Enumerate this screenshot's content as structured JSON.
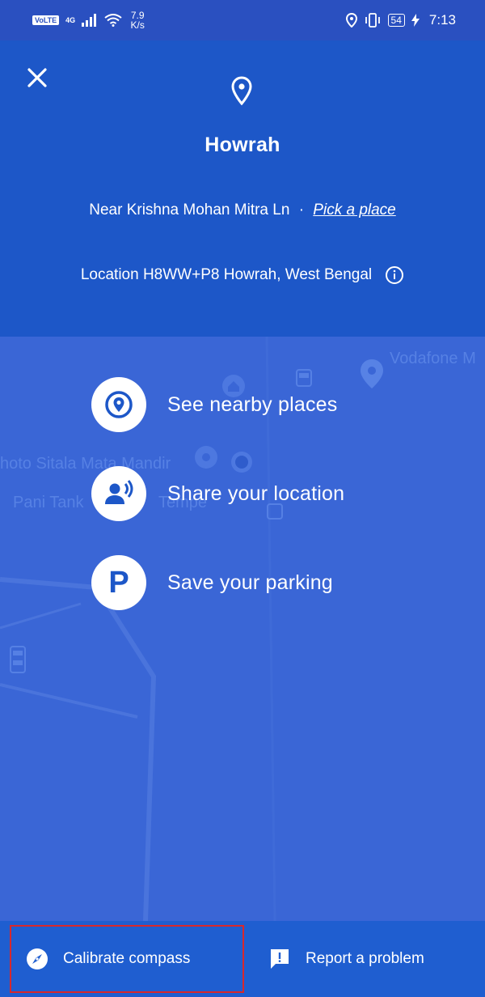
{
  "status_bar": {
    "volte": "VoLTE",
    "network": "4G",
    "speed_value": "7.9",
    "speed_unit": "K/s",
    "battery": "54",
    "time": "7:13"
  },
  "header": {
    "title": "Howrah",
    "address": "Near Krishna Mohan Mitra Ln",
    "separator": "·",
    "pick_place_link": "Pick a place",
    "location_code": "Location H8WW+P8 Howrah, West Bengal"
  },
  "map_labels": {
    "vodafone": "Vodafone M",
    "temple": "hoto Sitala Mata Mandir",
    "tank": "Pani Tank",
    "tank_suffix": "Tempe"
  },
  "actions": [
    {
      "label": "See nearby places",
      "icon": "nearby-places-icon"
    },
    {
      "label": "Share your location",
      "icon": "share-location-icon"
    },
    {
      "label": "Save your parking",
      "icon": "parking-icon"
    }
  ],
  "parking_glyph": "P",
  "bottom_bar": {
    "calibrate_label": "Calibrate compass",
    "report_label": "Report a problem"
  },
  "colors": {
    "header_blue": "#1d57c8",
    "overlay_blue": "#3a66d6",
    "highlight_red": "#d8282c"
  }
}
